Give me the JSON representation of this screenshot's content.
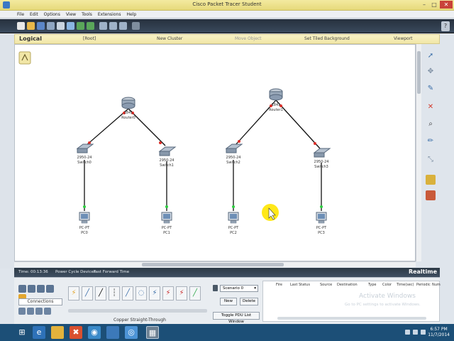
{
  "window": {
    "title": "Cisco Packet Tracer Student"
  },
  "menu": [
    "File",
    "Edit",
    "Options",
    "View",
    "Tools",
    "Extensions",
    "Help"
  ],
  "logical_bar": {
    "mode": "Logical",
    "root": "[Root]",
    "new_cluster": "New Cluster",
    "move_object": "Move Object",
    "set_tiled_background": "Set Tiled Background",
    "viewport": "Viewport"
  },
  "topology": {
    "routers": [
      {
        "model": "1841",
        "name": "Router0"
      },
      {
        "model": "1841",
        "name": "Router1"
      }
    ],
    "switches": [
      {
        "model": "2950-24",
        "name": "Switch0"
      },
      {
        "model": "2950-24",
        "name": "Switch1"
      },
      {
        "model": "2950-24",
        "name": "Switch2"
      },
      {
        "model": "2950-24",
        "name": "Switch3"
      }
    ],
    "pcs": [
      {
        "model": "PC-PT",
        "name": "PC0"
      },
      {
        "model": "PC-PT",
        "name": "PC1"
      },
      {
        "model": "PC-PT",
        "name": "PC2"
      },
      {
        "model": "PC-PT",
        "name": "PC3"
      }
    ]
  },
  "status": {
    "time": "Time: 00:13:36",
    "power_cycle": "Power Cycle Devices",
    "fast_forward": "Fast Forward Time",
    "mode": "Realtime"
  },
  "device_panel": {
    "category_label": "Connections",
    "cable_description": "Copper Straight-Through"
  },
  "scenario": {
    "selected": "Scenario 0",
    "new_label": "New",
    "delete_label": "Delete",
    "toggle_label": "Toggle PDU List Window"
  },
  "pdu_table": {
    "columns": [
      "Fire",
      "Last Status",
      "Source",
      "Destination",
      "Type",
      "Color",
      "Time(sec)",
      "Periodic",
      "Num"
    ]
  },
  "watermark": {
    "line1": "Activate Windows",
    "line2": "Go to PC settings to activate Windows."
  },
  "clock": {
    "time": "6:57 PM",
    "date": "11/7/2014"
  },
  "colors": {
    "link": "#111111",
    "port_up": "#2ecc40",
    "port_down": "#e0302a",
    "cursor_highlight": "#ffe600"
  }
}
